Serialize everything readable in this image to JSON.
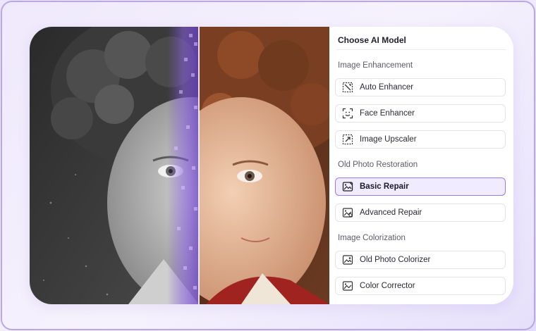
{
  "panel": {
    "title": "Choose AI Model",
    "sections": [
      {
        "label": "Image Enhancement",
        "items": [
          {
            "label": "Auto Enhancer",
            "icon": "auto-enhance-icon"
          },
          {
            "label": "Face Enhancer",
            "icon": "face-scan-icon"
          },
          {
            "label": "Image Upscaler",
            "icon": "upscale-icon"
          }
        ]
      },
      {
        "label": "Old Photo Restoration",
        "items": [
          {
            "label": "Basic Repair",
            "icon": "image-repair-icon",
            "selected": true
          },
          {
            "label": "Advanced Repair",
            "icon": "image-advanced-repair-icon"
          }
        ]
      },
      {
        "label": "Image Colorization",
        "items": [
          {
            "label": "Old Photo Colorizer",
            "icon": "image-colorize-icon"
          },
          {
            "label": "Color Corrector",
            "icon": "image-color-correct-icon"
          }
        ]
      }
    ]
  },
  "colors": {
    "accent": "#9b7be6",
    "selected_bg": "#f1ebff",
    "frame_border": "#b9a6ee"
  }
}
